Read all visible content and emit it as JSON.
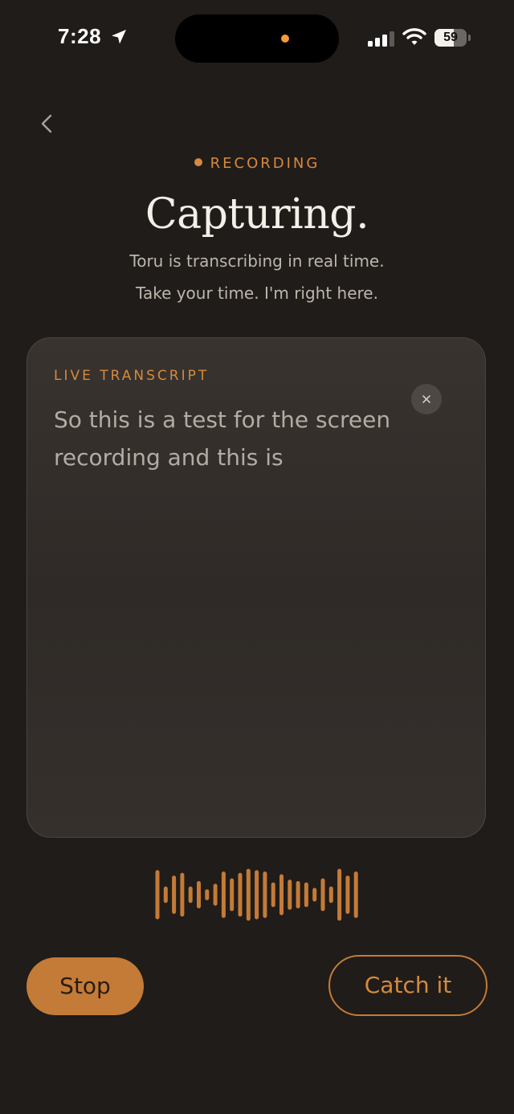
{
  "status_bar": {
    "time": "7:28",
    "battery_level": "59",
    "battery_fraction": 0.59,
    "icons": [
      "location-arrow-icon",
      "cellular-signal-icon",
      "wifi-icon",
      "battery-icon"
    ]
  },
  "header": {
    "back_icon": "chevron-left-icon",
    "status_label": "RECORDING",
    "title": "Capturing.",
    "subtitle_line_1": "Toru is transcribing in real time.",
    "subtitle_line_2": "Take your time. I'm right here."
  },
  "transcript": {
    "label": "LIVE TRANSCRIPT",
    "text": "So this is a test for the screen recording and this is",
    "clear_icon": "close-icon"
  },
  "waveform": {
    "levels": [
      0.9,
      0.3,
      0.7,
      0.8,
      0.3,
      0.5,
      0.2,
      0.4,
      0.85,
      0.6,
      0.8,
      0.95,
      0.9,
      0.85,
      0.45,
      0.75,
      0.55,
      0.5,
      0.45,
      0.25,
      0.6,
      0.3,
      0.95,
      0.7,
      0.85
    ]
  },
  "actions": {
    "stop_label": "Stop",
    "catch_label": "Catch it"
  },
  "colors": {
    "background": "#201c19",
    "accent": "#c47b37",
    "accent_text": "#d68a3d",
    "card": "#36312d"
  }
}
